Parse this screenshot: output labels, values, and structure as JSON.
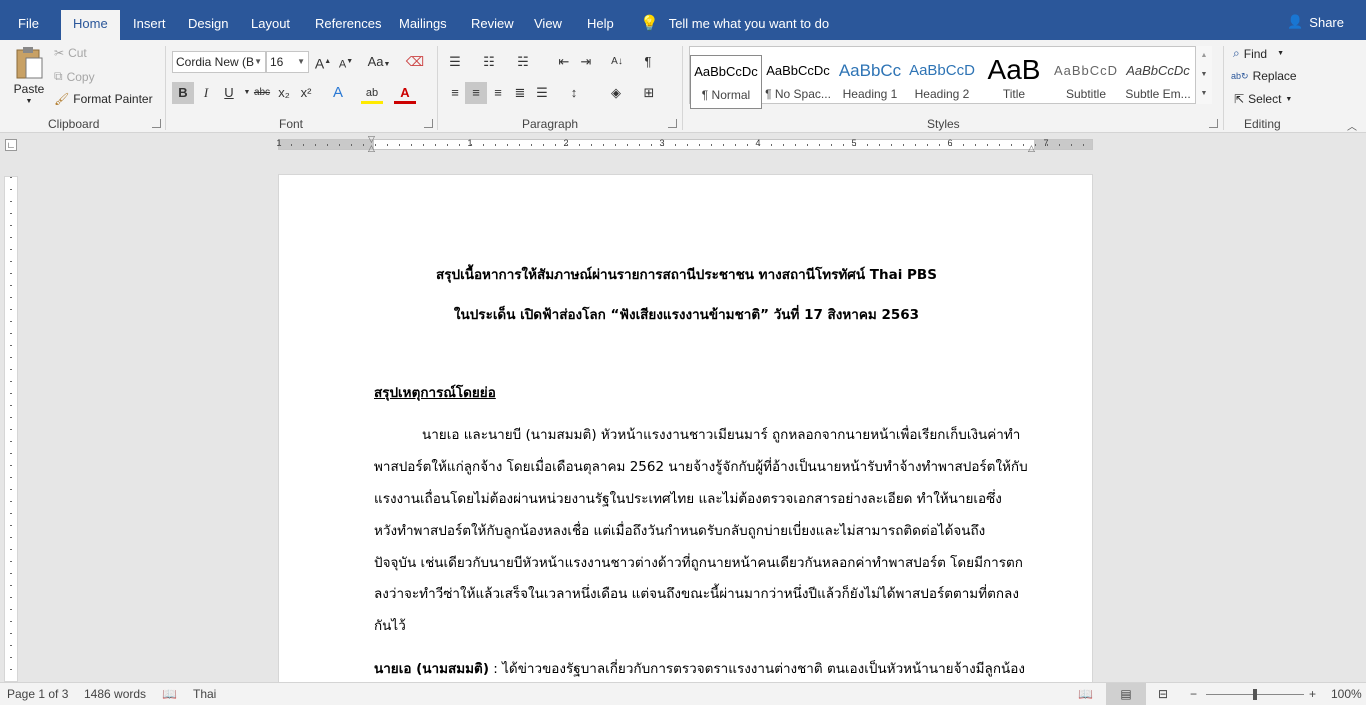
{
  "tabs": [
    {
      "label": "File"
    },
    {
      "label": "Home"
    },
    {
      "label": "Insert"
    },
    {
      "label": "Design"
    },
    {
      "label": "Layout"
    },
    {
      "label": "References"
    },
    {
      "label": "Mailings"
    },
    {
      "label": "Review"
    },
    {
      "label": "View"
    },
    {
      "label": "Help"
    }
  ],
  "tellme": "Tell me what you want to do",
  "share": "Share",
  "clipboard": {
    "paste": "Paste",
    "cut": "Cut",
    "copy": "Copy",
    "format_painter": "Format Painter",
    "label": "Clipboard"
  },
  "font": {
    "name": "Cordia New (B",
    "size": "16",
    "label": "Font",
    "bold": "B",
    "italic": "I",
    "underline": "U",
    "strike": "abc",
    "sub": "x₂",
    "sup": "x²",
    "grow": "A",
    "shrink": "A",
    "case": "Aa"
  },
  "paragraph": {
    "label": "Paragraph"
  },
  "styles": {
    "label": "Styles",
    "items": [
      {
        "preview": "AaBbCcDc",
        "name": "¶ Normal"
      },
      {
        "preview": "AaBbCcDc",
        "name": "¶ No Spac..."
      },
      {
        "preview": "AaBbCc",
        "name": "Heading 1"
      },
      {
        "preview": "AaBbCcD",
        "name": "Heading 2"
      },
      {
        "preview": "AaB",
        "name": "Title"
      },
      {
        "preview": "AaBbCcD",
        "name": "Subtitle"
      },
      {
        "preview": "AaBbCcDc",
        "name": "Subtle Em..."
      }
    ]
  },
  "editing": {
    "label": "Editing",
    "find": "Find",
    "replace": "Replace",
    "select": "Select"
  },
  "ruler_numbers": [
    "1",
    "1",
    "2",
    "3",
    "4",
    "5",
    "6",
    "7"
  ],
  "document": {
    "title1": "สรุปเนื้อหาการให้สัมภาษณ์ผ่านรายการสถานีประชาชน ทางสถานีโทรทัศน์ Thai PBS",
    "title2": "ในประเด็น เปิดฟ้าส่องโลก “ฟังเสียงแรงงานข้ามชาติ” วันที่ 17 สิงหาคม 2563",
    "heading": "สรุปเหตุการณ์โดยย่อ",
    "para_lines": [
      "นายเอ และนายบี (นามสมมติ) หัวหน้าแรงงานชาวเมียนมาร์ ถูกหลอกจากนายหน้าเพื่อเรียกเก็บเงินค่าทำ",
      "พาสปอร์ตให้แก่ลูกจ้าง โดยเมื่อเดือนตุลาคม 2562 นายจ้างรู้จักกับผู้ที่อ้างเป็นนายหน้ารับทำจ้างทำพาสปอร์ตให้กับ",
      "แรงงานเถื่อนโดยไม่ต้องผ่านหน่วยงานรัฐในประเทศไทย และไม่ต้องตรวจเอกสารอย่างละเอียด ทำให้นายเอซึ่ง",
      "หวังทำพาสปอร์ตให้กับลูกน้องหลงเชื่อ แต่เมื่อถึงวันกำหนดรับกลับถูกบ่ายเบี่ยงและไม่สามารถติดต่อได้จนถึง",
      "ปัจจุบัน เช่นเดียวกับนายบีหัวหน้าแรงงานชาวต่างด้าวที่ถูกนายหน้าคนเดียวกันหลอกค่าทำพาสปอร์ต โดยมีการตก",
      "ลงว่าจะทำวีซ่าให้แล้วเสร็จในเวลาหนึ่งเดือน แต่จนถึงขณะนี้ผ่านมากว่าหนึ่งปีแล้วก็ยังไม่ได้พาสปอร์ตตามที่ตกลง",
      "กันไว้"
    ],
    "speaker": "นายเอ (นามสมมติ)",
    "speaker_text": " : ได้ข่าวของรัฐบาลเกี่ยวกับการตรวจตราแรงงานต่างชาติ ตนเองเป็นหัวหน้านายจ้างมีลูกน้อง"
  },
  "status": {
    "page": "Page 1 of 3",
    "words": "1486 words",
    "lang": "Thai",
    "zoom": "100%"
  },
  "colors": {
    "accent": "#2b579a"
  }
}
